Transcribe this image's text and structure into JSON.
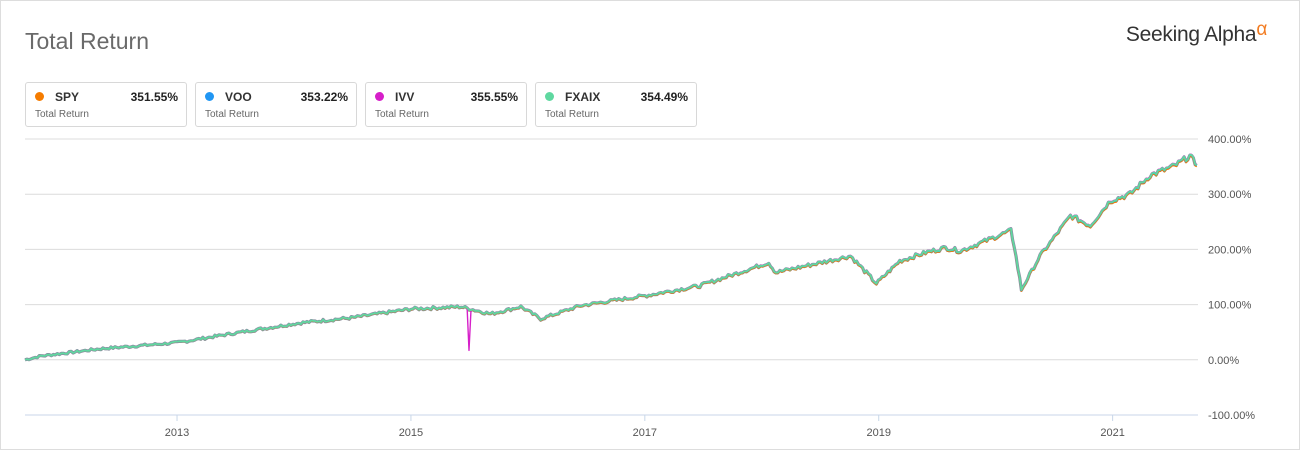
{
  "header": {
    "title": "Total Return",
    "logo_text": "Seeking Alpha",
    "logo_symbol": "α"
  },
  "legend": [
    {
      "ticker": "SPY",
      "value": "351.55%",
      "label": "Total Return",
      "color": "#f57c00"
    },
    {
      "ticker": "VOO",
      "value": "353.22%",
      "label": "Total Return",
      "color": "#2196f3"
    },
    {
      "ticker": "IVV",
      "value": "355.55%",
      "label": "Total Return",
      "color": "#d61fc9"
    },
    {
      "ticker": "FXAIX",
      "value": "354.49%",
      "label": "Total Return",
      "color": "#5fd8a0"
    }
  ],
  "chart_data": {
    "type": "line",
    "title": "Total Return",
    "xlabel": "",
    "ylabel": "",
    "xlim": [
      2011.7,
      2021.73
    ],
    "ylim": [
      -100,
      400
    ],
    "x_ticks": [
      2013,
      2015,
      2017,
      2019,
      2021
    ],
    "x_tick_labels": [
      "2013",
      "2015",
      "2017",
      "2019",
      "2021"
    ],
    "y_ticks": [
      400,
      300,
      200,
      100,
      0,
      -100
    ],
    "y_tick_labels": [
      "400.00%",
      "300.00%",
      "200.00%",
      "100.00%",
      "0.00%",
      "-100.00%"
    ],
    "grid": true,
    "base_series_points": [
      [
        2011.7,
        0
      ],
      [
        2011.84,
        7
      ],
      [
        2012.35,
        20
      ],
      [
        2013.0,
        31
      ],
      [
        2013.63,
        53
      ],
      [
        2014.06,
        67
      ],
      [
        2014.49,
        76
      ],
      [
        2015.0,
        92
      ],
      [
        2015.43,
        96
      ],
      [
        2015.68,
        83
      ],
      [
        2015.94,
        96
      ],
      [
        2016.11,
        74
      ],
      [
        2016.45,
        98
      ],
      [
        2017.0,
        116
      ],
      [
        2017.47,
        134
      ],
      [
        2018.06,
        176
      ],
      [
        2018.12,
        158
      ],
      [
        2018.76,
        188
      ],
      [
        2018.98,
        138
      ],
      [
        2019.18,
        179
      ],
      [
        2019.4,
        194
      ],
      [
        2019.57,
        203
      ],
      [
        2019.7,
        197
      ],
      [
        2020.13,
        234
      ],
      [
        2020.16,
        205
      ],
      [
        2020.22,
        127
      ],
      [
        2020.38,
        188
      ],
      [
        2020.64,
        261
      ],
      [
        2020.81,
        243
      ],
      [
        2020.98,
        288
      ],
      [
        2021.15,
        300
      ],
      [
        2021.32,
        334
      ],
      [
        2021.53,
        351
      ],
      [
        2021.66,
        369
      ],
      [
        2021.72,
        352
      ]
    ],
    "series": [
      {
        "name": "SPY",
        "final": 351.55,
        "offset": -2
      },
      {
        "name": "VOO",
        "final": 353.22,
        "offset": 0
      },
      {
        "name": "IVV",
        "final": 355.55,
        "offset": 2,
        "spike": {
          "x": 2015.5,
          "y": 17
        }
      },
      {
        "name": "FXAIX",
        "final": 354.49,
        "offset": 1
      }
    ]
  }
}
